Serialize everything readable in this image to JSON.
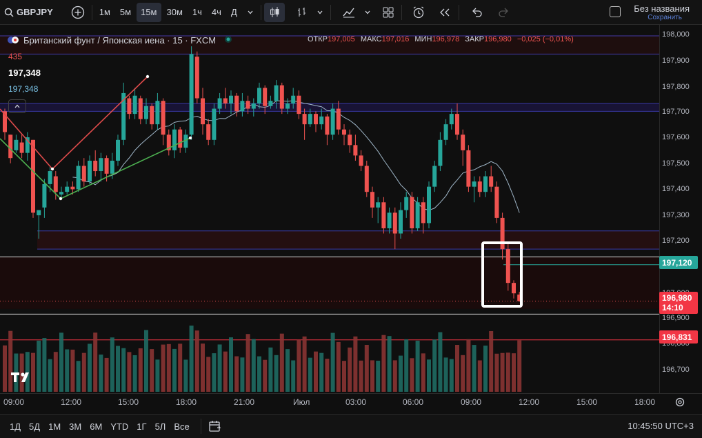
{
  "toolbar": {
    "symbol": "GBPJPY",
    "intervals": [
      "1м",
      "5м",
      "15м",
      "30м",
      "1ч",
      "4ч",
      "Д"
    ],
    "active_interval": "15м",
    "layout_title": "Без названия",
    "layout_status": "Сохранить"
  },
  "legend": {
    "title": "Британский фунт / Японская иена · 15 · FXCM",
    "open_label": "ОТКР",
    "open": "197,005",
    "high_label": "МАКС",
    "high": "197,016",
    "low_label": "МИН",
    "low": "196,978",
    "close_label": "ЗАКР",
    "close": "196,980",
    "change": "−0,025 (−0,01%)",
    "ind1": "435",
    "ind2": "197,348",
    "ind3": "197,348"
  },
  "price_scale": {
    "labels": [
      "198,000",
      "197,900",
      "197,800",
      "197,700",
      "197,600",
      "197,500",
      "197,400",
      "197,300",
      "197,200",
      "197,000",
      "196,900",
      "196,800",
      "196,700"
    ],
    "tag_green": "197,120",
    "tag_last": "196,980",
    "tag_countdown": "14:10",
    "tag_red": "196,831"
  },
  "time_scale": {
    "labels": [
      "09:00",
      "12:00",
      "15:00",
      "18:00",
      "21:00",
      "Июл",
      "03:00",
      "06:00",
      "09:00",
      "12:00",
      "15:00",
      "18:00"
    ]
  },
  "bottombar": {
    "ranges": [
      "1Д",
      "5Д",
      "1М",
      "3М",
      "6М",
      "YTD",
      "1Г",
      "5Л",
      "Все"
    ],
    "clock": "10:45:50 UTC+3"
  },
  "colors": {
    "up": "#26a69a",
    "down": "#ef5350",
    "background": "#0f0f0f",
    "ma_line": "#9fb6c8"
  },
  "chart_data": {
    "type": "candlestick",
    "symbol": "GBPJPY",
    "interval": "15",
    "ylim": [
      196.6,
      198.04
    ],
    "candles": [
      {
        "o": 197.71,
        "h": 197.72,
        "l": 197.6,
        "c": 197.63
      },
      {
        "o": 197.62,
        "h": 197.62,
        "l": 197.51,
        "c": 197.53
      },
      {
        "o": 197.56,
        "h": 197.62,
        "l": 197.55,
        "c": 197.6
      },
      {
        "o": 197.59,
        "h": 197.62,
        "l": 197.53,
        "c": 197.55
      },
      {
        "o": 197.55,
        "h": 197.63,
        "l": 197.52,
        "c": 197.61
      },
      {
        "o": 197.6,
        "h": 197.6,
        "l": 197.3,
        "c": 197.32
      },
      {
        "o": 197.31,
        "h": 197.31,
        "l": 197.22,
        "c": 197.33
      },
      {
        "o": 197.34,
        "h": 197.45,
        "l": 197.3,
        "c": 197.43
      },
      {
        "o": 197.43,
        "h": 197.5,
        "l": 197.4,
        "c": 197.48
      },
      {
        "o": 197.46,
        "h": 197.48,
        "l": 197.37,
        "c": 197.4
      },
      {
        "o": 197.39,
        "h": 197.42,
        "l": 197.38,
        "c": 197.4
      },
      {
        "o": 197.4,
        "h": 197.44,
        "l": 197.39,
        "c": 197.42
      },
      {
        "o": 197.42,
        "h": 197.44,
        "l": 197.39,
        "c": 197.41
      },
      {
        "o": 197.41,
        "h": 197.52,
        "l": 197.4,
        "c": 197.5
      },
      {
        "o": 197.5,
        "h": 197.53,
        "l": 197.42,
        "c": 197.44
      },
      {
        "o": 197.44,
        "h": 197.54,
        "l": 197.43,
        "c": 197.52
      },
      {
        "o": 197.52,
        "h": 197.56,
        "l": 197.46,
        "c": 197.48
      },
      {
        "o": 197.48,
        "h": 197.55,
        "l": 197.44,
        "c": 197.53
      },
      {
        "o": 197.53,
        "h": 197.54,
        "l": 197.44,
        "c": 197.47
      },
      {
        "o": 197.47,
        "h": 197.55,
        "l": 197.45,
        "c": 197.52
      },
      {
        "o": 197.52,
        "h": 197.62,
        "l": 197.5,
        "c": 197.6
      },
      {
        "o": 197.6,
        "h": 197.82,
        "l": 197.58,
        "c": 197.78
      },
      {
        "o": 197.76,
        "h": 197.77,
        "l": 197.68,
        "c": 197.7
      },
      {
        "o": 197.7,
        "h": 197.8,
        "l": 197.68,
        "c": 197.77
      },
      {
        "o": 197.76,
        "h": 197.77,
        "l": 197.66,
        "c": 197.68
      },
      {
        "o": 197.68,
        "h": 197.76,
        "l": 197.66,
        "c": 197.73
      },
      {
        "o": 197.73,
        "h": 197.74,
        "l": 197.64,
        "c": 197.66
      },
      {
        "o": 197.66,
        "h": 197.78,
        "l": 197.64,
        "c": 197.75
      },
      {
        "o": 197.75,
        "h": 197.76,
        "l": 197.58,
        "c": 197.62
      },
      {
        "o": 197.62,
        "h": 197.64,
        "l": 197.54,
        "c": 197.56
      },
      {
        "o": 197.56,
        "h": 197.66,
        "l": 197.53,
        "c": 197.64
      },
      {
        "o": 197.64,
        "h": 197.65,
        "l": 197.55,
        "c": 197.57
      },
      {
        "o": 197.57,
        "h": 197.64,
        "l": 197.55,
        "c": 197.62
      },
      {
        "o": 197.62,
        "h": 197.96,
        "l": 197.6,
        "c": 197.93
      },
      {
        "o": 197.92,
        "h": 197.94,
        "l": 197.74,
        "c": 197.76
      },
      {
        "o": 197.76,
        "h": 197.8,
        "l": 197.62,
        "c": 197.66
      },
      {
        "o": 197.66,
        "h": 197.68,
        "l": 197.58,
        "c": 197.6
      },
      {
        "o": 197.6,
        "h": 197.74,
        "l": 197.58,
        "c": 197.72
      },
      {
        "o": 197.72,
        "h": 197.78,
        "l": 197.7,
        "c": 197.76
      },
      {
        "o": 197.76,
        "h": 197.8,
        "l": 197.72,
        "c": 197.74
      },
      {
        "o": 197.74,
        "h": 197.79,
        "l": 197.7,
        "c": 197.77
      },
      {
        "o": 197.77,
        "h": 197.78,
        "l": 197.69,
        "c": 197.71
      },
      {
        "o": 197.71,
        "h": 197.78,
        "l": 197.69,
        "c": 197.75
      },
      {
        "o": 197.75,
        "h": 197.77,
        "l": 197.7,
        "c": 197.72
      },
      {
        "o": 197.72,
        "h": 197.76,
        "l": 197.69,
        "c": 197.74
      },
      {
        "o": 197.74,
        "h": 197.82,
        "l": 197.72,
        "c": 197.8
      },
      {
        "o": 197.8,
        "h": 197.81,
        "l": 197.7,
        "c": 197.73
      },
      {
        "o": 197.73,
        "h": 197.77,
        "l": 197.72,
        "c": 197.75
      },
      {
        "o": 197.75,
        "h": 197.83,
        "l": 197.72,
        "c": 197.81
      },
      {
        "o": 197.81,
        "h": 197.82,
        "l": 197.7,
        "c": 197.72
      },
      {
        "o": 197.72,
        "h": 197.76,
        "l": 197.7,
        "c": 197.74
      },
      {
        "o": 197.74,
        "h": 197.8,
        "l": 197.72,
        "c": 197.77
      },
      {
        "o": 197.77,
        "h": 197.79,
        "l": 197.68,
        "c": 197.7
      },
      {
        "o": 197.7,
        "h": 197.72,
        "l": 197.6,
        "c": 197.66
      },
      {
        "o": 197.66,
        "h": 197.72,
        "l": 197.65,
        "c": 197.7
      },
      {
        "o": 197.7,
        "h": 197.71,
        "l": 197.63,
        "c": 197.66
      },
      {
        "o": 197.66,
        "h": 197.72,
        "l": 197.64,
        "c": 197.69
      },
      {
        "o": 197.69,
        "h": 197.7,
        "l": 197.58,
        "c": 197.62
      },
      {
        "o": 197.62,
        "h": 197.74,
        "l": 197.6,
        "c": 197.72
      },
      {
        "o": 197.72,
        "h": 197.75,
        "l": 197.62,
        "c": 197.64
      },
      {
        "o": 197.64,
        "h": 197.66,
        "l": 197.58,
        "c": 197.62
      },
      {
        "o": 197.62,
        "h": 197.64,
        "l": 197.55,
        "c": 197.58
      },
      {
        "o": 197.58,
        "h": 197.62,
        "l": 197.52,
        "c": 197.54
      },
      {
        "o": 197.54,
        "h": 197.56,
        "l": 197.48,
        "c": 197.5
      },
      {
        "o": 197.5,
        "h": 197.52,
        "l": 197.38,
        "c": 197.4
      },
      {
        "o": 197.4,
        "h": 197.42,
        "l": 197.3,
        "c": 197.34
      },
      {
        "o": 197.34,
        "h": 197.38,
        "l": 197.28,
        "c": 197.36
      },
      {
        "o": 197.36,
        "h": 197.38,
        "l": 197.24,
        "c": 197.26
      },
      {
        "o": 197.26,
        "h": 197.34,
        "l": 197.24,
        "c": 197.32
      },
      {
        "o": 197.32,
        "h": 197.34,
        "l": 197.18,
        "c": 197.24
      },
      {
        "o": 197.24,
        "h": 197.36,
        "l": 197.22,
        "c": 197.33
      },
      {
        "o": 197.33,
        "h": 197.4,
        "l": 197.3,
        "c": 197.38
      },
      {
        "o": 197.38,
        "h": 197.4,
        "l": 197.24,
        "c": 197.26
      },
      {
        "o": 197.26,
        "h": 197.38,
        "l": 197.25,
        "c": 197.36
      },
      {
        "o": 197.36,
        "h": 197.38,
        "l": 197.24,
        "c": 197.28
      },
      {
        "o": 197.28,
        "h": 197.44,
        "l": 197.26,
        "c": 197.42
      },
      {
        "o": 197.42,
        "h": 197.52,
        "l": 197.4,
        "c": 197.5
      },
      {
        "o": 197.5,
        "h": 197.63,
        "l": 197.48,
        "c": 197.6
      },
      {
        "o": 197.6,
        "h": 197.68,
        "l": 197.58,
        "c": 197.66
      },
      {
        "o": 197.66,
        "h": 197.72,
        "l": 197.64,
        "c": 197.7
      },
      {
        "o": 197.7,
        "h": 197.74,
        "l": 197.6,
        "c": 197.62
      },
      {
        "o": 197.62,
        "h": 197.64,
        "l": 197.5,
        "c": 197.56
      },
      {
        "o": 197.56,
        "h": 197.58,
        "l": 197.4,
        "c": 197.42
      },
      {
        "o": 197.42,
        "h": 197.46,
        "l": 197.36,
        "c": 197.44
      },
      {
        "o": 197.44,
        "h": 197.46,
        "l": 197.38,
        "c": 197.4
      },
      {
        "o": 197.4,
        "h": 197.48,
        "l": 197.38,
        "c": 197.46
      },
      {
        "o": 197.46,
        "h": 197.5,
        "l": 197.4,
        "c": 197.42
      },
      {
        "o": 197.42,
        "h": 197.44,
        "l": 197.28,
        "c": 197.3
      },
      {
        "o": 197.3,
        "h": 197.32,
        "l": 197.14,
        "c": 197.18
      },
      {
        "o": 197.18,
        "h": 197.2,
        "l": 197.02,
        "c": 197.05
      },
      {
        "o": 197.05,
        "h": 197.06,
        "l": 196.99,
        "c": 197.01
      },
      {
        "o": 197.005,
        "h": 197.016,
        "l": 196.978,
        "c": 196.98
      }
    ]
  }
}
